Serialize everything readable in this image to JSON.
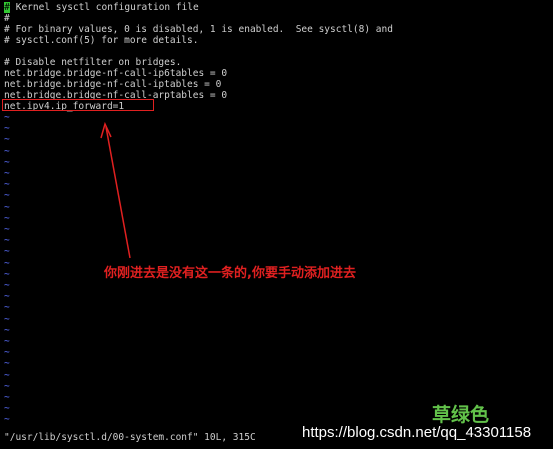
{
  "editor": {
    "cursor_char": "#",
    "lines": [
      " Kernel sysctl configuration file",
      "#",
      "# For binary values, 0 is disabled, 1 is enabled.  See sysctl(8) and",
      "# sysctl.conf(5) for more details.",
      "",
      "# Disable netfilter on bridges.",
      "net.bridge.bridge-nf-call-ip6tables = 0",
      "net.bridge.bridge-nf-call-iptables = 0",
      "net.bridge.bridge-nf-call-arptables = 0",
      "net.ipv4.ip_forward=1"
    ],
    "tilde": "~",
    "status_line": "\"/usr/lib/sysctl.d/00-system.conf\" 10L, 315C"
  },
  "annotation": {
    "text": "你刚进去是没有这一条的,你要手动添加进去",
    "color": "#e02020"
  },
  "watermark": {
    "logo_text": "草绿色",
    "url": "https://blog.csdn.net/qq_43301158"
  },
  "colors": {
    "background": "#000000",
    "text": "#cfcfcf",
    "tilde": "#5a6fff",
    "cursor": "#32c832",
    "annotation": "#e02020"
  }
}
